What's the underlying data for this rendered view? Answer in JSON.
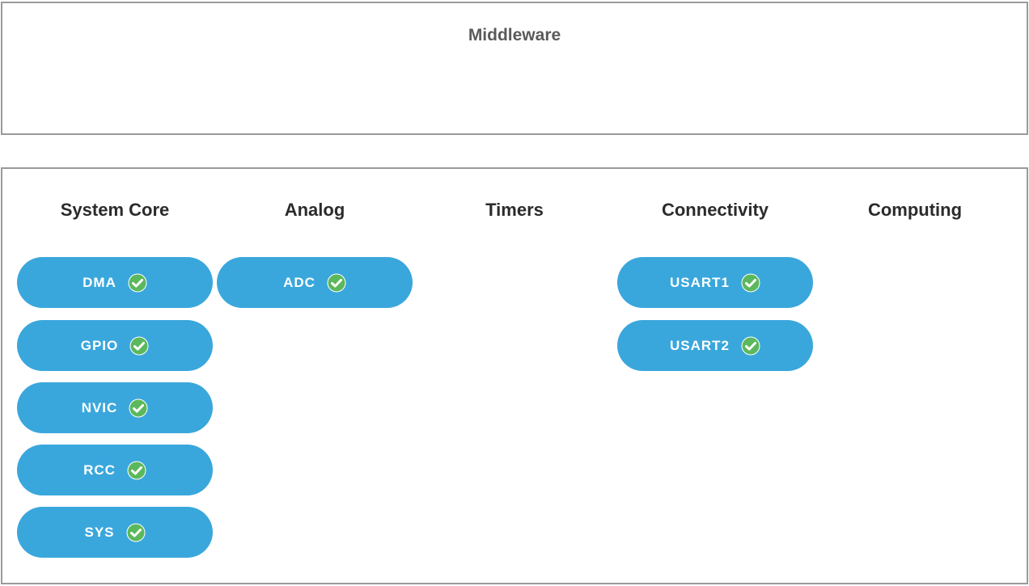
{
  "middleware": {
    "title": "Middleware"
  },
  "categories": {
    "columns": [
      {
        "name": "System Core",
        "items": [
          {
            "label": "DMA",
            "status": "configured-check-icon"
          },
          {
            "label": "GPIO",
            "status": "configured-check-icon"
          },
          {
            "label": "NVIC",
            "status": "configured-check-icon"
          },
          {
            "label": "RCC",
            "status": "configured-check-icon"
          },
          {
            "label": "SYS",
            "status": "configured-check-icon"
          }
        ]
      },
      {
        "name": "Analog",
        "items": [
          {
            "label": "ADC",
            "status": "configured-check-icon"
          }
        ]
      },
      {
        "name": "Timers",
        "items": []
      },
      {
        "name": "Connectivity",
        "items": [
          {
            "label": "USART1",
            "status": "configured-check-icon"
          },
          {
            "label": "USART2",
            "status": "configured-check-icon"
          }
        ]
      },
      {
        "name": "Computing",
        "items": []
      }
    ]
  },
  "colors": {
    "pill_background": "#3aa7dc",
    "check_fill": "#5cb85c",
    "panel_border": "#9a9a9a"
  }
}
